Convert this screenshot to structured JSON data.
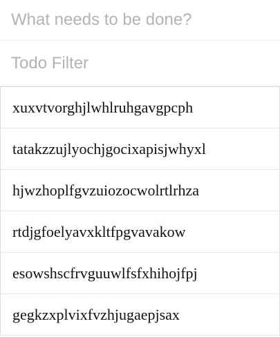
{
  "new_todo": {
    "placeholder": "What needs to be done?",
    "value": ""
  },
  "filter": {
    "placeholder": "Todo Filter",
    "value": ""
  },
  "todos": [
    {
      "label": "xuxvtvorghjlwhlruhgavgpcph"
    },
    {
      "label": "tatakzzujlyochjgocixapisjwhyxl"
    },
    {
      "label": "hjwzhoplfgvzuiozocwolrtlrhza"
    },
    {
      "label": "rtdjgfoelyavxkltfpgvavakow"
    },
    {
      "label": "esowshscfrvguuwlfsfxhihojfpj"
    },
    {
      "label": "gegkzxplvixfvzhjugaepjsax"
    }
  ]
}
